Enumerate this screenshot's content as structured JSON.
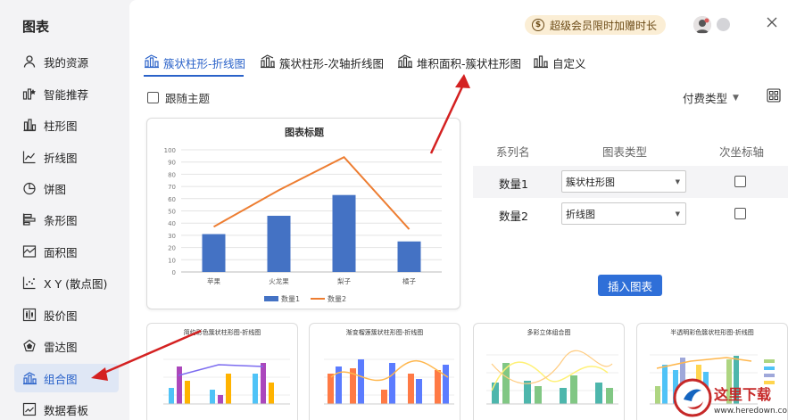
{
  "sidebar": {
    "title": "图表",
    "items": [
      {
        "label": "我的资源",
        "icon": "person-icon"
      },
      {
        "label": "智能推荐",
        "icon": "smart-recommend-icon"
      },
      {
        "label": "柱形图",
        "icon": "bar-chart-icon"
      },
      {
        "label": "折线图",
        "icon": "line-chart-icon"
      },
      {
        "label": "饼图",
        "icon": "pie-chart-icon"
      },
      {
        "label": "条形图",
        "icon": "horizontal-bar-icon"
      },
      {
        "label": "面积图",
        "icon": "area-chart-icon"
      },
      {
        "label": "X Y (散点图)",
        "icon": "scatter-chart-icon"
      },
      {
        "label": "股价图",
        "icon": "stock-chart-icon"
      },
      {
        "label": "雷达图",
        "icon": "radar-chart-icon"
      },
      {
        "label": "组合图",
        "icon": "combo-chart-icon"
      },
      {
        "label": "数据看板",
        "icon": "dashboard-icon"
      }
    ],
    "active_index": 10
  },
  "header": {
    "promo": "超级会员限时加赠时长",
    "promo_icon": "coin-icon",
    "close_icon": "close-icon"
  },
  "tabs": [
    {
      "label": "簇状柱形-折线图",
      "icon": "combo-chart-icon"
    },
    {
      "label": "簇状柱形-次轴折线图",
      "icon": "combo-chart-icon"
    },
    {
      "label": "堆积面积-簇状柱形图",
      "icon": "combo-chart-icon"
    },
    {
      "label": "自定义",
      "icon": "custom-chart-icon"
    }
  ],
  "options": {
    "follow_theme": "跟随主题",
    "pay_type": "付费类型"
  },
  "series_config": {
    "headers": {
      "name": "系列名",
      "type": "图表类型",
      "secondary": "次坐标轴"
    },
    "rows": [
      {
        "name": "数量1",
        "type": "簇状柱形图"
      },
      {
        "name": "数量2",
        "type": "折线图"
      }
    ],
    "insert_button": "插入图表"
  },
  "chart_data": {
    "type": "bar",
    "title": "图表标题",
    "categories": [
      "苹果",
      "火龙果",
      "梨子",
      "橘子"
    ],
    "series": [
      {
        "name": "数量1",
        "type": "bar",
        "values": [
          31,
          46,
          63,
          25
        ],
        "color": "#4472c4"
      },
      {
        "name": "数量2",
        "type": "line",
        "values": [
          37,
          67,
          94,
          35
        ],
        "color": "#ed7d31"
      }
    ],
    "ylim": [
      0,
      100
    ],
    "yticks": [
      0,
      10,
      20,
      30,
      40,
      50,
      60,
      70,
      80,
      90,
      100
    ],
    "grid": true,
    "legend": "bottom"
  },
  "thumbnails": [
    {
      "title": "简约彩色簇状柱形图-折线图"
    },
    {
      "title": "渐变榴莲簇状柱形图-折线图"
    },
    {
      "title": "多彩立体组合图"
    },
    {
      "title": "半透明彩色簇状柱形图-折线图"
    }
  ],
  "watermark": {
    "text": "这里下载",
    "url_text": "www.heredown.com"
  }
}
